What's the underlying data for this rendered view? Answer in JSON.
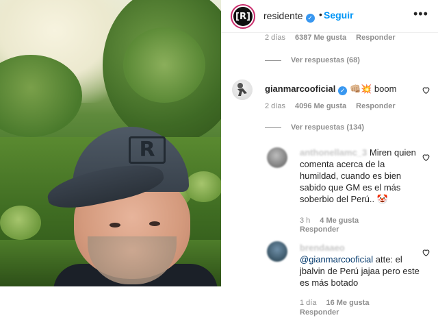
{
  "header": {
    "avatar_text": "[R]",
    "username": "residente",
    "verified_mark": "✓",
    "separator": "•",
    "follow_label": "Seguir",
    "more_label": "•••"
  },
  "top_comment_meta": {
    "age": "2 días",
    "likes": "6387 Me gusta",
    "reply": "Responder"
  },
  "top_view_replies": "Ver respuestas (68)",
  "comment_main": {
    "username": "gianmarcooficial",
    "verified_mark": "✓",
    "text": "👊🏼💥 boom",
    "age": "2 días",
    "likes": "4096 Me gusta",
    "reply": "Responder",
    "view_replies": "Ver respuestas (134)"
  },
  "reply_1": {
    "username_blurred": "anthonellamc_3",
    "text": "Miren quien comenta acerca de la humildad, cuando es bien sabido que GM es el más soberbio del Perú.. 🤡",
    "age": "3 h",
    "likes": "4 Me gusta",
    "reply": "Responder"
  },
  "reply_2": {
    "username_blurred": "brendaaeo",
    "mention": "@gianmarcooficial",
    "text": " atte: el jbalvin de Perú jajaa pero este es más botado",
    "age": "1 día",
    "likes": "16 Me gusta",
    "reply": "Responder"
  },
  "colors": {
    "link_blue": "#0095f6",
    "verified_blue": "#3897f0",
    "meta_gray": "#8e8e8e",
    "mention_blue": "#00376b"
  },
  "icons": [
    "heart-icon",
    "verified-icon",
    "more-icon"
  ]
}
